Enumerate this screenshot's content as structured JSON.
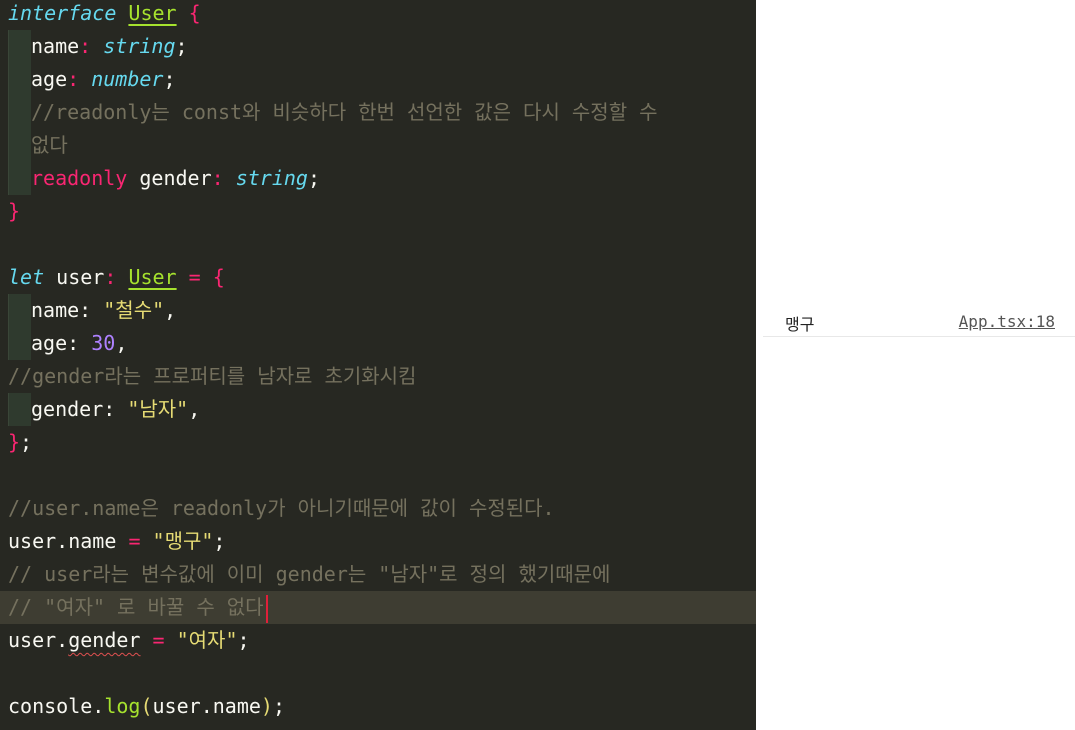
{
  "editor": {
    "kw_interface": "interface",
    "kw_let": "let",
    "kw_readonly": "readonly",
    "type_user": "User",
    "type_string": "string",
    "type_number": "number",
    "prop_name": "name",
    "prop_age": "age",
    "prop_gender": "gender",
    "var_user": "user",
    "fn_console": "console",
    "fn_log": "log",
    "str_cheolsu": "\"철수\"",
    "num_30": "30",
    "str_namja": "\"남자\"",
    "str_maenggu": "\"맹구\"",
    "str_yeoja": "\"여자\"",
    "comment_readonly_1": "//readonly는 const와 비슷하다 한번 선언한 값은 다시 수정할 수",
    "comment_readonly_2": "없다",
    "comment_gender_init": "//gender라는 프로퍼티를 남자로 초기화시킴",
    "comment_name_editable": "//user.name은 readonly가 아니기때문에 값이 수정된다.",
    "comment_gender_defined": "// user라는 변수값에 이미 gender는 \"남자\"로 정의 했기때문에",
    "comment_cannot_change": "// \"여자\" 로 바꿀 수 없다"
  },
  "console": {
    "message": "맹구",
    "source_link": "App.tsx:18"
  },
  "colors": {
    "editor_bg": "#272822",
    "keyword": "#f92672",
    "type": "#66d9ef",
    "class": "#a6e22e",
    "string": "#e6db74",
    "number": "#ae81ff",
    "comment": "#75715e",
    "error_squiggle": "#e05050",
    "cursor": "#e0203a"
  }
}
